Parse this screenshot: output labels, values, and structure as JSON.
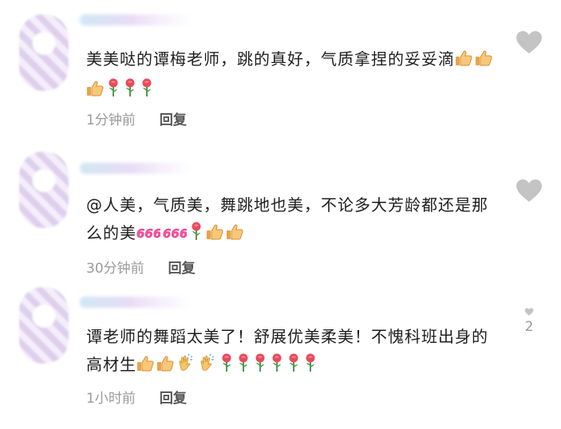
{
  "comments": [
    {
      "text": "美美哒的谭梅老师，跳的真好，气质拿捏的妥妥滴",
      "time": "1分钟前",
      "reply": "回复",
      "like_count": "",
      "emoji": [
        "thumbs-up-icon",
        "thumbs-up-icon",
        "thumbs-up-icon",
        "rose-icon",
        "rose-icon",
        "rose-icon"
      ]
    },
    {
      "text": "@人美，气质美，舞跳地也美，不论多大芳龄都还是那么的美",
      "time": "30分钟前",
      "reply": "回复",
      "like_count": "",
      "emoji": [
        "666-icon",
        "666-icon",
        "rose-icon",
        "thumbs-up-icon",
        "thumbs-up-icon"
      ]
    },
    {
      "text": "谭老师的舞蹈太美了！舒展优美柔美！不愧科班出身的高材生",
      "time": "1小时前",
      "reply": "回复",
      "like_count": "2",
      "emoji": [
        "thumbs-up-icon",
        "thumbs-up-icon",
        "clap-icon",
        "clap-icon",
        "rose-icon",
        "rose-icon",
        "rose-icon",
        "rose-icon",
        "rose-icon",
        "rose-icon"
      ]
    }
  ],
  "colors": {
    "text": "#1e1e1e",
    "meta": "#9a9a9a",
    "heart": "#c4c4c4",
    "reply": "#555555"
  }
}
